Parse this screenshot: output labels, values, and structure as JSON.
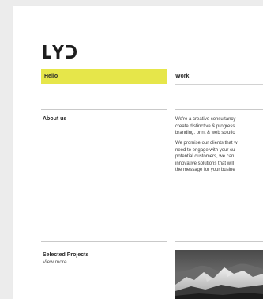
{
  "brand": {
    "logo_text": "LYD"
  },
  "nav": {
    "hello_label": "Hello",
    "work_label": "Work"
  },
  "about": {
    "heading": "About us",
    "paragraph1": "We're a creative consultancy\ncreate distinctive & progress\nbranding, print & web solutio",
    "paragraph2": "We promise our clients that w\nneed to engage with your cu\npotential customers, we can\ninnovative solutions that will\nthe message for your busine"
  },
  "projects": {
    "heading": "Selected Projects",
    "view_more": "View more"
  },
  "colors": {
    "accent": "#e6e64a",
    "text": "#2b2b2b"
  }
}
